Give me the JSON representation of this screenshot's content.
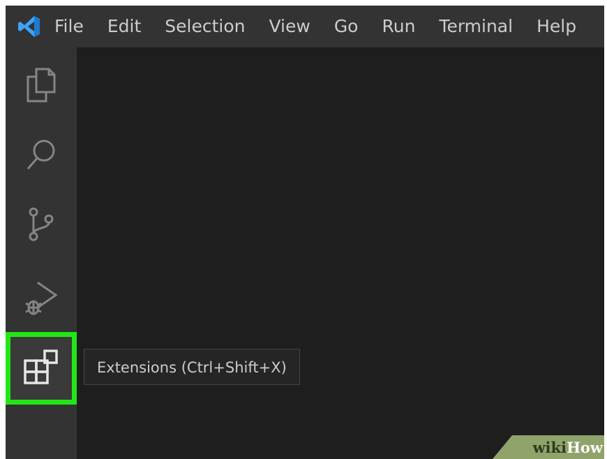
{
  "menubar": {
    "logo_icon": "vscode-logo-icon",
    "items": [
      "File",
      "Edit",
      "Selection",
      "View",
      "Go",
      "Run",
      "Terminal",
      "Help"
    ]
  },
  "activitybar": {
    "items": [
      {
        "icon": "explorer-files-icon"
      },
      {
        "icon": "search-icon"
      },
      {
        "icon": "source-control-icon"
      },
      {
        "icon": "run-debug-icon"
      },
      {
        "icon": "extensions-icon",
        "active": true
      }
    ],
    "highlight_color": "#22e617"
  },
  "tooltip": {
    "text": "Extensions (Ctrl+Shift+X)"
  },
  "watermark": {
    "wiki": "wiki",
    "how": "How"
  },
  "colors": {
    "titlebar": "#333333",
    "activitybar": "#333333",
    "editor": "#1e1e1e",
    "logo_blue": "#3ea3f5"
  }
}
